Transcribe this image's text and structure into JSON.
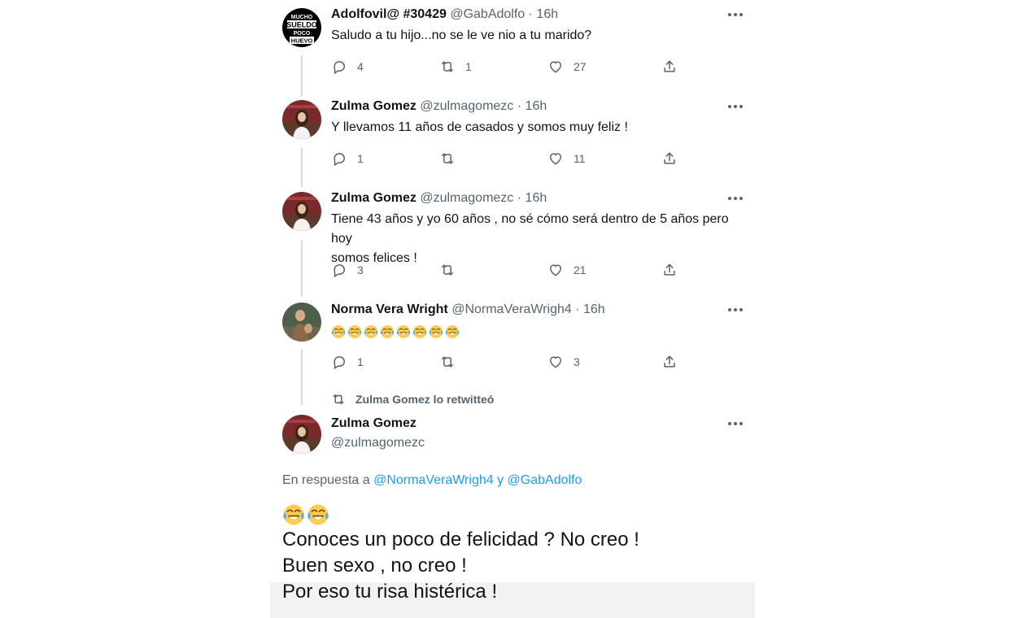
{
  "tweets": [
    {
      "name": "Adolfovil@ #30429",
      "handle": "@GabAdolfo",
      "time": "16h",
      "text": "Saludo a tu hijo...no se le ve nio a tu marido?",
      "avatar_text": [
        "MUCHO",
        "SUELDO",
        "POCO",
        "HUEVO"
      ],
      "replies": "4",
      "retweets": "1",
      "likes": "27"
    },
    {
      "name": "Zulma Gomez",
      "handle": "@zulmagomezc",
      "time": "16h",
      "text": "Y llevamos 11 años de casados y somos muy feliz !",
      "replies": "1",
      "retweets": "",
      "likes": "11"
    },
    {
      "name": "Zulma Gomez",
      "handle": "@zulmagomezc",
      "time": "16h",
      "text_lines": [
        "Tiene 43 años y yo 60 años , no sé cómo será dentro de 5 años pero hoy",
        "somos felices !"
      ],
      "replies": "3",
      "retweets": "",
      "likes": "21"
    },
    {
      "name": "Norma Vera Wright",
      "handle": "@NormaVeraWrigh4",
      "time": "16h",
      "emoji": "face-with-tears-of-joy",
      "emoji_count": 8,
      "replies": "1",
      "retweets": "",
      "likes": "3"
    }
  ],
  "retweet_note": "Zulma Gomez lo retwitteó",
  "main_tweet": {
    "name": "Zulma Gomez",
    "handle": "@zulmagomezc",
    "reply_prefix": "En respuesta a",
    "reply_user_1": "@NormaVeraWrigh4",
    "reply_joiner": "y",
    "reply_user_2": "@GabAdolfo",
    "emoji_count": 2,
    "lines": [
      "Conoces un poco de felicidad ? No creo !",
      "Buen sexo , no creo !",
      "Por eso tu risa histérica !"
    ]
  },
  "separator": "·",
  "colors": {
    "text": "#0f1419",
    "secondary": "#536471",
    "link": "#1d9bf0",
    "thread_line": "#cfd9de"
  }
}
